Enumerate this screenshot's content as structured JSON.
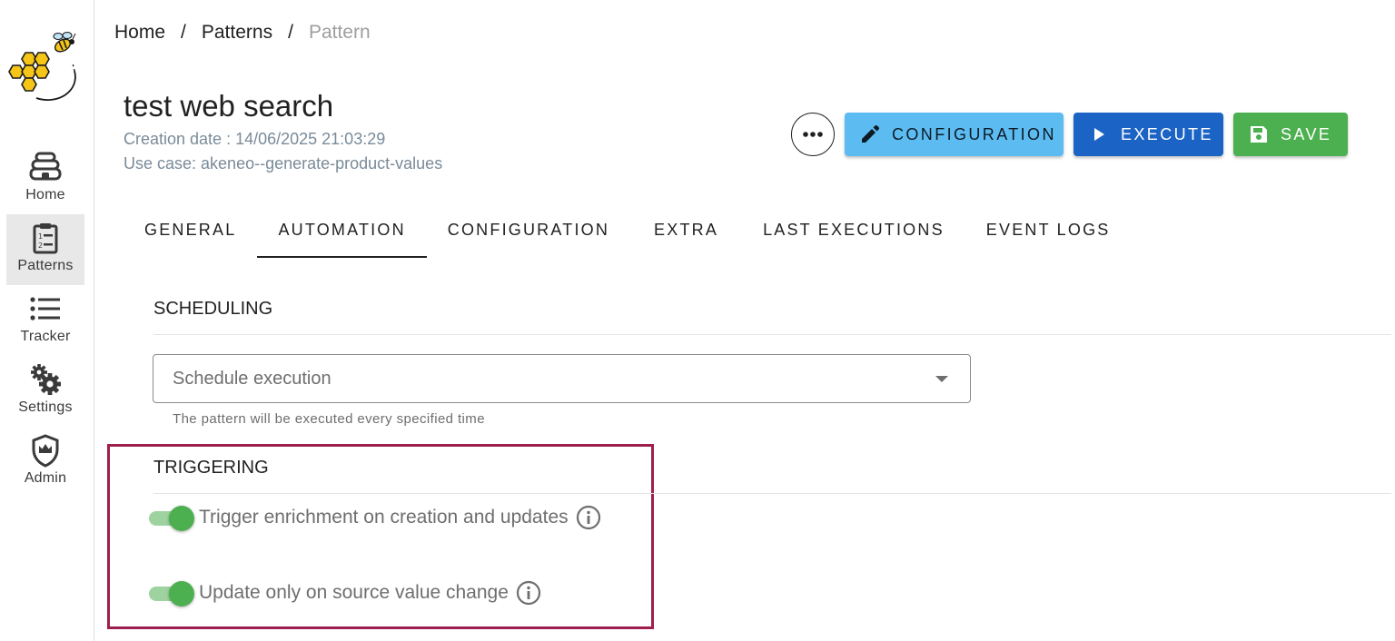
{
  "breadcrumb": {
    "items": [
      "Home",
      "Patterns",
      "Pattern"
    ],
    "separator": "/"
  },
  "sidebar": {
    "items": [
      {
        "label": "Home",
        "icon": "beehive-icon"
      },
      {
        "label": "Patterns",
        "icon": "clipboard-list-icon",
        "active": true
      },
      {
        "label": "Tracker",
        "icon": "list-icon"
      },
      {
        "label": "Settings",
        "icon": "gears-icon"
      },
      {
        "label": "Admin",
        "icon": "shield-crown-icon"
      }
    ]
  },
  "header": {
    "title": "test web search",
    "creation_date": "Creation date : 14/06/2025 21:03:29",
    "use_case": "Use case: akeneo--generate-product-values"
  },
  "actions": {
    "more_icon": "more-horizontal-icon",
    "configuration_label": "CONFIGURATION",
    "execute_label": "EXECUTE",
    "save_label": "SAVE"
  },
  "tabs": [
    {
      "label": "GENERAL"
    },
    {
      "label": "AUTOMATION",
      "active": true
    },
    {
      "label": "CONFIGURATION"
    },
    {
      "label": "EXTRA"
    },
    {
      "label": "LAST EXECUTIONS"
    },
    {
      "label": "EVENT LOGS"
    }
  ],
  "scheduling": {
    "title": "SCHEDULING",
    "select_placeholder": "Schedule execution",
    "helper_text": "The pattern will be executed every specified time"
  },
  "triggering": {
    "title": "TRIGGERING",
    "toggles": [
      {
        "label": "Trigger enrichment on creation and updates",
        "checked": true
      },
      {
        "label": "Update only on source value change",
        "checked": true
      }
    ]
  },
  "colors": {
    "configuration_button": "#5cbcf2",
    "execute_button": "#1b63c4",
    "save_button": "#4caf50",
    "toggle_on": "#4caf50",
    "highlight_border": "#9e1f4d"
  }
}
